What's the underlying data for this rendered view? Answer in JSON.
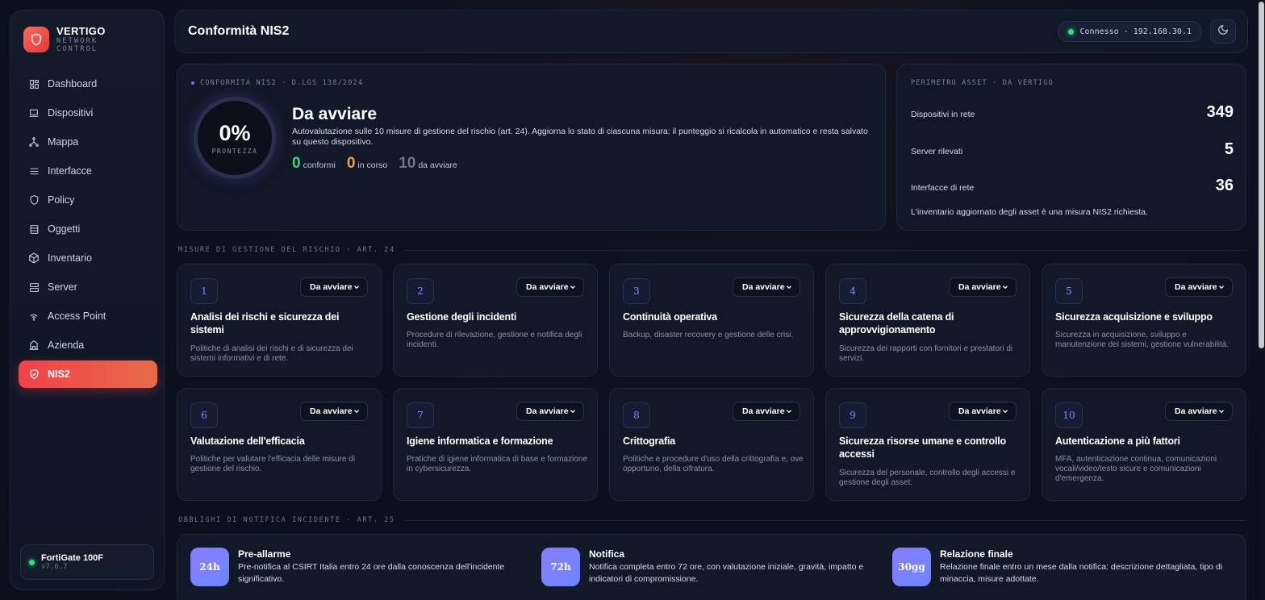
{
  "brand": {
    "name": "VERTIGO",
    "sub1": "NETWORK",
    "sub2": "CONTROL"
  },
  "nav": [
    {
      "label": "Dashboard",
      "icon": "dashboard-icon"
    },
    {
      "label": "Dispositivi",
      "icon": "laptop-icon"
    },
    {
      "label": "Mappa",
      "icon": "network-icon"
    },
    {
      "label": "Interfacce",
      "icon": "list-icon"
    },
    {
      "label": "Policy",
      "icon": "shield-icon"
    },
    {
      "label": "Oggetti",
      "icon": "database-icon"
    },
    {
      "label": "Inventario",
      "icon": "box-icon"
    },
    {
      "label": "Server",
      "icon": "server-icon"
    },
    {
      "label": "Access Point",
      "icon": "wifi-icon"
    },
    {
      "label": "Azienda",
      "icon": "building-icon"
    },
    {
      "label": "NIS2",
      "icon": "shield-check-icon",
      "active": true
    }
  ],
  "device": {
    "name": "FortiGate 100F",
    "version": "v7.6.7"
  },
  "topbar": {
    "title": "Conformità NIS2",
    "connection": "Connesso · 192.168.30.1"
  },
  "hero": {
    "eyebrow": "CONFORMITÀ NIS2 · D.LGS 138/2024",
    "score": "0%",
    "score_label": "PRONTEZZA",
    "status": "Da avviare",
    "description": "Autovalutazione sulle 10 misure di gestione del rischio (art. 24). Aggiorna lo stato di ciascuna misura: il punteggio si ricalcola in automatico e resta salvato su questo dispositivo.",
    "stats": [
      {
        "value": "0",
        "label": "conformi",
        "color": "#2ddc86"
      },
      {
        "value": "0",
        "label": "in corso",
        "color": "#f5a524"
      },
      {
        "value": "10",
        "label": "da avviare",
        "color": "#6f7789"
      }
    ]
  },
  "assets": {
    "eyebrow": "PERIMETRO ASSET · DA VERTIGO",
    "rows": [
      {
        "label": "Dispositivi in rete",
        "value": "349"
      },
      {
        "label": "Server rilevati",
        "value": "5"
      },
      {
        "label": "Interfacce di rete",
        "value": "36"
      }
    ],
    "note": "L'inventario aggiornato degli asset è una misura NIS2 richiesta."
  },
  "measures_label": "MISURE DI GESTIONE DEL RISCHIO · ART. 24",
  "measures": [
    {
      "num": "1",
      "status": "Da avviare",
      "title": "Analisi dei rischi e sicurezza dei sistemi",
      "desc": "Politiche di analisi dei rischi e di sicurezza dei sistemi informativi e di rete."
    },
    {
      "num": "2",
      "status": "Da avviare",
      "title": "Gestione degli incidenti",
      "desc": "Procedure di rilevazione, gestione e notifica degli incidenti."
    },
    {
      "num": "3",
      "status": "Da avviare",
      "title": "Continuità operativa",
      "desc": "Backup, disaster recovery e gestione delle crisi."
    },
    {
      "num": "4",
      "status": "Da avviare",
      "title": "Sicurezza della catena di approvvigionamento",
      "desc": "Sicurezza dei rapporti con fornitori e prestatori di servizi."
    },
    {
      "num": "5",
      "status": "Da avviare",
      "title": "Sicurezza acquisizione e sviluppo",
      "desc": "Sicurezza in acquisizione, sviluppo e manutenzione dei sistemi, gestione vulnerabilità."
    },
    {
      "num": "6",
      "status": "Da avviare",
      "title": "Valutazione dell'efficacia",
      "desc": "Politiche per valutare l'efficacia delle misure di gestione del rischio."
    },
    {
      "num": "7",
      "status": "Da avviare",
      "title": "Igiene informatica e formazione",
      "desc": "Pratiche di igiene informatica di base e formazione in cybersicurezza."
    },
    {
      "num": "8",
      "status": "Da avviare",
      "title": "Crittografia",
      "desc": "Politiche e procedure d'uso della crittografia e, ove opportuno, della cifratura."
    },
    {
      "num": "9",
      "status": "Da avviare",
      "title": "Sicurezza risorse umane e controllo accessi",
      "desc": "Sicurezza del personale, controllo degli accessi e gestione degli asset."
    },
    {
      "num": "10",
      "status": "Da avviare",
      "title": "Autenticazione a più fattori",
      "desc": "MFA, autenticazione continua, comunicazioni vocali/video/testo sicure e comunicazioni d'emergenza."
    }
  ],
  "notif_label": "OBBLIGHI DI NOTIFICA INCIDENTE · ART. 25",
  "notifications": [
    {
      "badge": "24h",
      "title": "Pre-allarme",
      "desc": "Pre-notifica al CSIRT Italia entro 24 ore dalla conoscenza dell'incidente significativo."
    },
    {
      "badge": "72h",
      "title": "Notifica",
      "desc": "Notifica completa entro 72 ore, con valutazione iniziale, gravità, impatto e indicatori di compromissione."
    },
    {
      "badge": "30gg",
      "title": "Relazione finale",
      "desc": "Relazione finale entro un mese dalla notifica: descrizione dettagliata, tipo di minaccia, misure adottate."
    }
  ]
}
